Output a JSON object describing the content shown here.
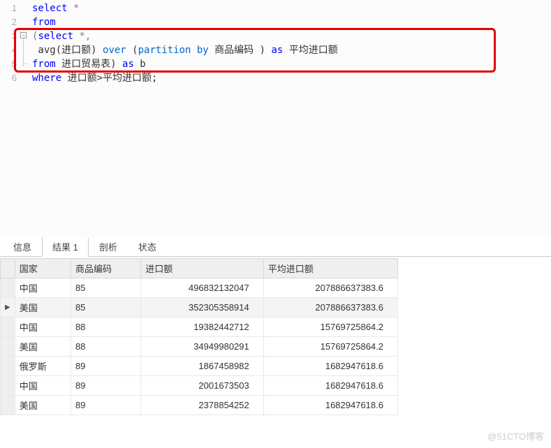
{
  "editor": {
    "lines": [
      {
        "n": "1",
        "tokens": [
          [
            "kw",
            "select"
          ],
          [
            "txt",
            " "
          ],
          [
            "sym",
            "*"
          ]
        ]
      },
      {
        "n": "2",
        "tokens": [
          [
            "kw",
            "from"
          ]
        ]
      },
      {
        "n": "3",
        "fold": "start",
        "tokens": [
          [
            "sym",
            "("
          ],
          [
            "kw",
            "select"
          ],
          [
            "txt",
            " "
          ],
          [
            "sym",
            "*"
          ],
          [
            "sym",
            ","
          ]
        ]
      },
      {
        "n": "4",
        "tokens": [
          [
            "txt",
            " avg(进口额) "
          ],
          [
            "kw2",
            "over"
          ],
          [
            "txt",
            " ("
          ],
          [
            "kw2",
            "partition by"
          ],
          [
            "txt",
            " 商品编码 ) "
          ],
          [
            "kw",
            "as"
          ],
          [
            "txt",
            " 平均进口额"
          ]
        ]
      },
      {
        "n": "5",
        "fold": "end",
        "tokens": [
          [
            "kw",
            "from"
          ],
          [
            "txt",
            " 进口贸易表) "
          ],
          [
            "kw",
            "as"
          ],
          [
            "txt",
            " b"
          ]
        ]
      },
      {
        "n": "6",
        "tokens": [
          [
            "kw",
            "where"
          ],
          [
            "txt",
            " 进口额>平均进口额;"
          ]
        ]
      }
    ]
  },
  "tabs": {
    "items": [
      "信息",
      "结果 1",
      "剖析",
      "状态"
    ],
    "active": 1
  },
  "results": {
    "columns": [
      "国家",
      "商品编码",
      "进口额",
      "平均进口额"
    ],
    "rows": [
      {
        "c0": "中国",
        "c1": "85",
        "c2": "496832132047",
        "c3": "207886637383.6",
        "sel": false
      },
      {
        "c0": "美国",
        "c1": "85",
        "c2": "352305358914",
        "c3": "207886637383.6",
        "sel": true
      },
      {
        "c0": "中国",
        "c1": "88",
        "c2": "19382442712",
        "c3": "15769725864.2",
        "sel": false
      },
      {
        "c0": "美国",
        "c1": "88",
        "c2": "34949980291",
        "c3": "15769725864.2",
        "sel": false
      },
      {
        "c0": "俄罗斯",
        "c1": "89",
        "c2": "1867458982",
        "c3": "1682947618.6",
        "sel": false
      },
      {
        "c0": "中国",
        "c1": "89",
        "c2": "2001673503",
        "c3": "1682947618.6",
        "sel": false
      },
      {
        "c0": "美国",
        "c1": "89",
        "c2": "2378854252",
        "c3": "1682947618.6",
        "sel": false
      }
    ]
  },
  "watermark": "@51CTO博客"
}
